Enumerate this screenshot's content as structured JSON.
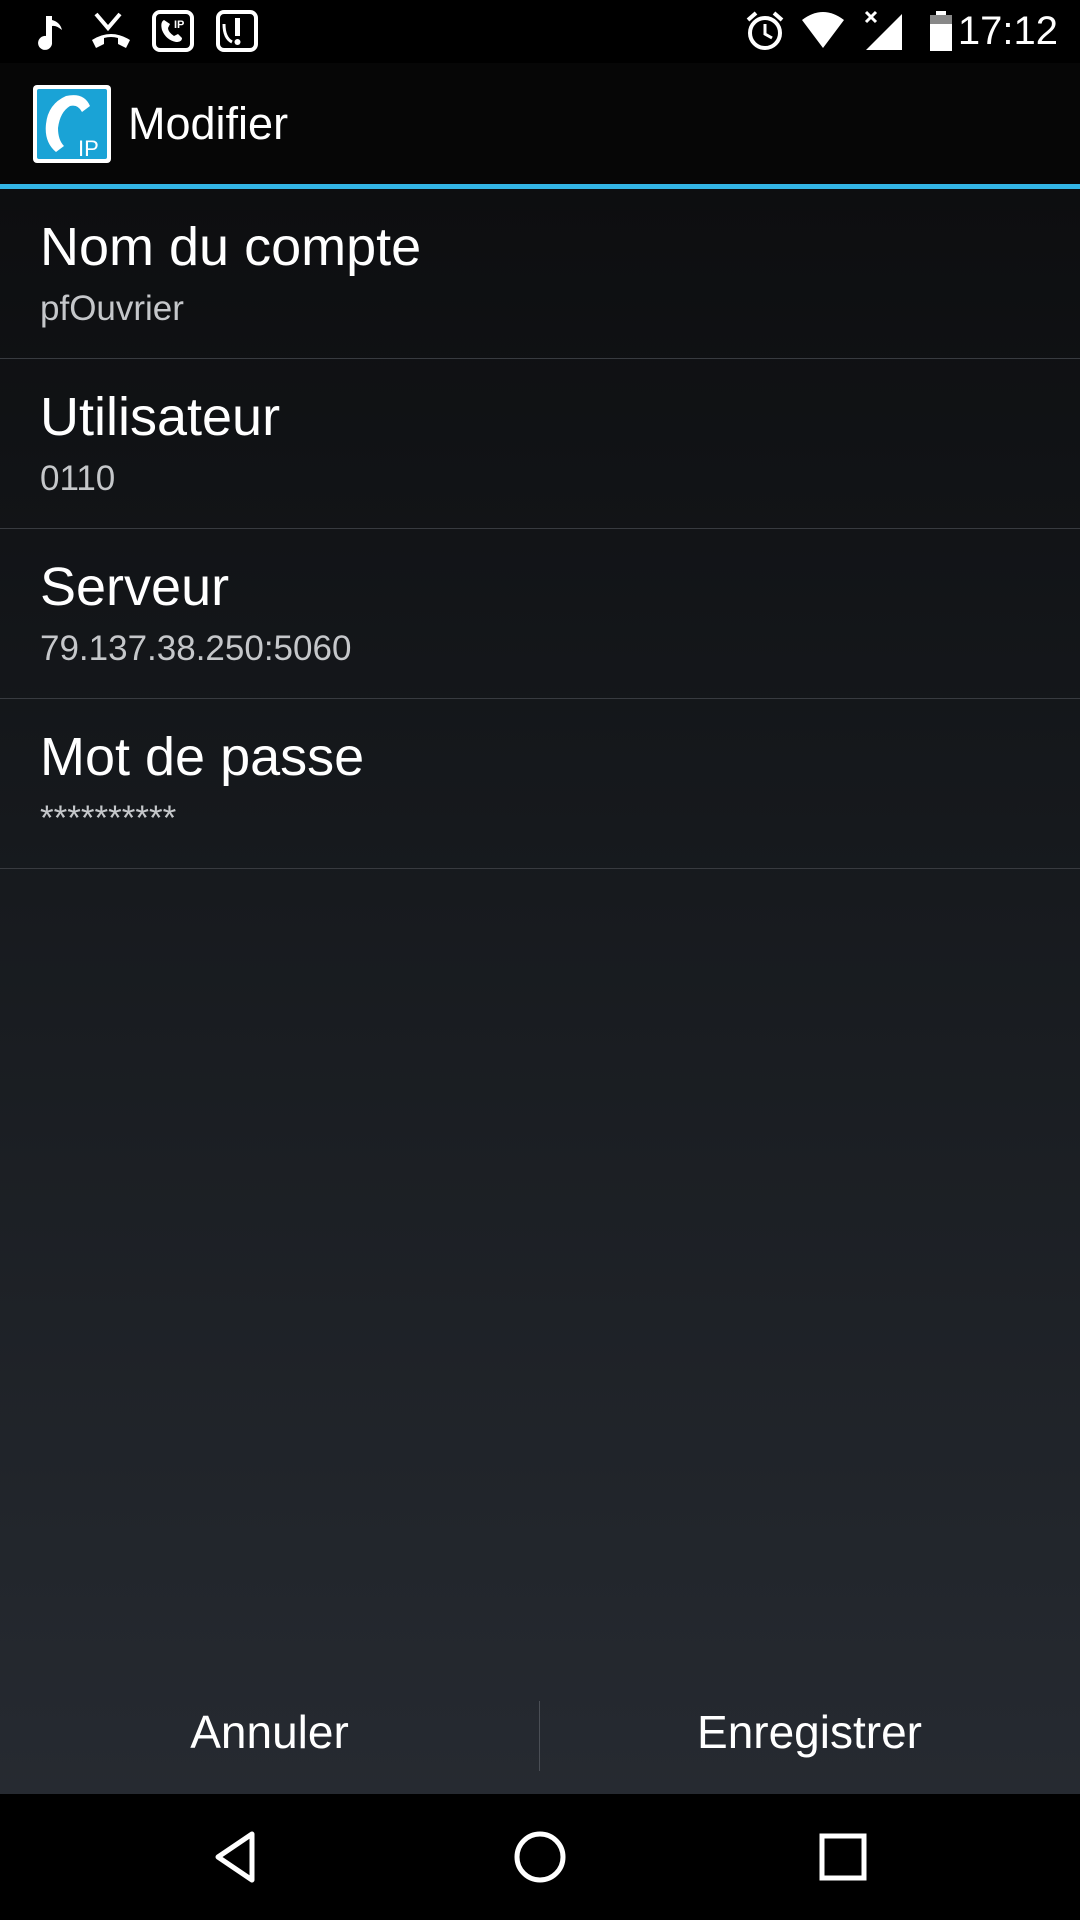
{
  "status_bar": {
    "time": "17:12",
    "left_icons": [
      "music-note-icon",
      "missed-call-icon",
      "sip-phone-icon",
      "voicemail-alert-icon"
    ],
    "right_icons": [
      "alarm-icon",
      "wifi-icon",
      "cell-signal-no-data-icon",
      "battery-icon"
    ]
  },
  "action_bar": {
    "title": "Modifier",
    "app_icon_label": "IP",
    "accent_color": "#33b5e5"
  },
  "preferences": [
    {
      "title": "Nom du compte",
      "summary": "pfOuvrier"
    },
    {
      "title": "Utilisateur",
      "summary": "0110"
    },
    {
      "title": "Serveur",
      "summary": "79.137.38.250:5060"
    },
    {
      "title": "Mot de passe",
      "summary": "**********"
    }
  ],
  "buttons": {
    "cancel": "Annuler",
    "save": "Enregistrer"
  },
  "nav_bar": {
    "icons": [
      "back-icon",
      "home-icon",
      "recents-icon"
    ]
  }
}
